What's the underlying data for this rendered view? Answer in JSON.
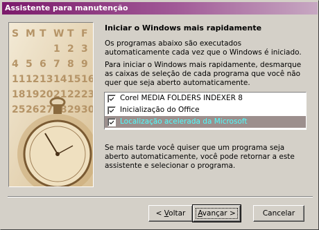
{
  "window": {
    "title": "Assistente para manutenção"
  },
  "heading": "Iniciar o Windows mais rapidamente",
  "paragraphs": {
    "p1": "Os programas abaixo são executados automaticamente cada vez que o Windows é iniciado.",
    "p2": "Para iniciar o Windows mais rapidamente, desmarque as caixas de seleção de cada programa que você não quer que seja aberto automaticamente.",
    "p3": "Se mais tarde você quiser que um programa seja aberto automaticamente, você pode retornar a este assistente e selecionar o programa."
  },
  "programs": [
    {
      "label": "Corel MEDIA FOLDERS INDEXER 8",
      "checked": true,
      "selected": false
    },
    {
      "label": "Inicialização do Office",
      "checked": true,
      "selected": false
    },
    {
      "label": "Localização acelerada da Microsoft",
      "checked": true,
      "selected": true
    }
  ],
  "illustration": {
    "calendar_header": [
      "S",
      "M",
      "T",
      "W",
      "T",
      "F"
    ],
    "calendar_rows": [
      [
        "",
        "",
        "",
        "1",
        "2",
        "3"
      ],
      [
        "4",
        "5",
        "6",
        "7",
        "8",
        "9"
      ],
      [
        "11",
        "12",
        "13",
        "14",
        "15",
        "16"
      ],
      [
        "18",
        "19",
        "20",
        "21",
        "22",
        "23"
      ],
      [
        "25",
        "26",
        "27",
        "28",
        "29",
        "30"
      ]
    ]
  },
  "buttons": {
    "back": {
      "pre": "< ",
      "mnemonic": "V",
      "rest": "oltar"
    },
    "next": {
      "pre": "",
      "mnemonic": "A",
      "rest": "vançar >"
    },
    "cancel": "Cancelar"
  },
  "colors": {
    "title_gradient_start": "#7b1a6b",
    "selection_bg": "#9c8f8d",
    "selection_text": "#4dffff",
    "face": "#d4d0c8"
  }
}
